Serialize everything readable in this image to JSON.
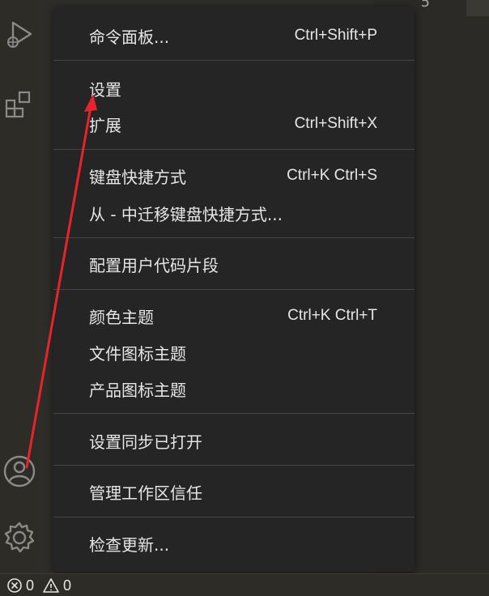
{
  "editor": {
    "line_number": "5"
  },
  "activity_bar": {
    "icons": [
      "run-debug-icon",
      "extensions-icon",
      "account-icon",
      "manage-gear-icon"
    ]
  },
  "menu": {
    "items": [
      {
        "label": "命令面板...",
        "shortcut": "Ctrl+Shift+P"
      },
      {
        "label": "设置",
        "shortcut": ""
      },
      {
        "label": "扩展",
        "shortcut": "Ctrl+Shift+X"
      },
      {
        "label": "键盘快捷方式",
        "shortcut": "Ctrl+K Ctrl+S"
      },
      {
        "label": "从 - 中迁移键盘快捷方式...",
        "shortcut": ""
      },
      {
        "label": "配置用户代码片段",
        "shortcut": ""
      },
      {
        "label": "颜色主题",
        "shortcut": "Ctrl+K Ctrl+T"
      },
      {
        "label": "文件图标主题",
        "shortcut": ""
      },
      {
        "label": "产品图标主题",
        "shortcut": ""
      },
      {
        "label": "设置同步已打开",
        "shortcut": ""
      },
      {
        "label": "管理工作区信任",
        "shortcut": ""
      },
      {
        "label": "检查更新...",
        "shortcut": ""
      }
    ]
  },
  "status_bar": {
    "errors": "0",
    "warnings": "0"
  },
  "annotation": {
    "arrow_color": "#e8232a"
  }
}
